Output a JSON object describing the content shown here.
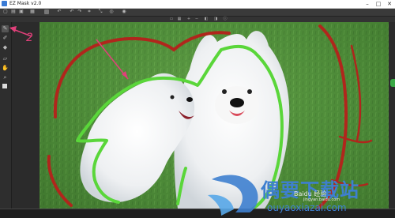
{
  "window": {
    "title": "EZ Mask v2.0",
    "controls": {
      "minimize": "–",
      "maximize": "□",
      "close": "✕"
    }
  },
  "toolbar": {
    "top_icons": [
      "new-icon",
      "open-icon",
      "save-icon",
      "avatar-icon",
      "undo-icon",
      "redo-icon",
      "crop-icon",
      "zoom-icon",
      "mask-icon"
    ],
    "secondary_icons": [
      "fit-icon",
      "grid-icon",
      "zoom-in-icon",
      "zoom-out-icon",
      "view-icon",
      "compare-icon",
      "info-icon"
    ]
  },
  "left_tools": [
    {
      "name": "pen-icon",
      "active": true
    },
    {
      "name": "brush-icon",
      "active": false
    },
    {
      "name": "fill-icon",
      "active": false
    },
    {
      "name": "eraser-icon",
      "active": false
    },
    {
      "name": "hand-icon",
      "active": false
    },
    {
      "name": "zoom-icon",
      "active": false
    },
    {
      "name": "color-icon",
      "active": false
    }
  ],
  "annotations": {
    "number_label": "2"
  },
  "watermark": {
    "main": "偶要下载站",
    "brand": "Baidu 经验",
    "url": "jingyan.baidu.com",
    "sub": "ouyaoxiazai.com"
  },
  "colors": {
    "keep_stroke": "#5ad63a",
    "drop_stroke": "#b0261c",
    "annotation": "#e0407a",
    "watermark": "#3e7fcf"
  }
}
